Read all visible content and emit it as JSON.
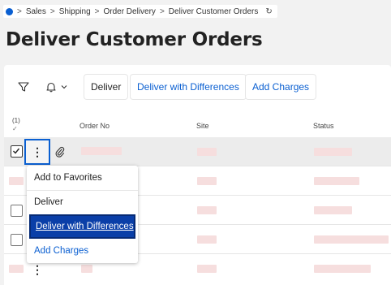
{
  "breadcrumb": {
    "items": [
      "Sales",
      "Shipping",
      "Order Delivery",
      "Deliver Customer Orders"
    ],
    "separator": ">"
  },
  "page_title": "Deliver Customer Orders",
  "toolbar": {
    "deliver_label": "Deliver",
    "deliver_with_differences_label": "Deliver with Differences",
    "add_charges_label": "Add Charges"
  },
  "table": {
    "selected_count": "(1)",
    "columns": [
      "Order No",
      "Site",
      "Status"
    ],
    "row_count": 5
  },
  "context_menu": {
    "items": [
      "Add to Favorites",
      "Deliver",
      "Deliver with Differences",
      "Add Charges"
    ],
    "highlighted": "Deliver with Differences"
  },
  "colors": {
    "accent": "#0a5fd1",
    "menu_highlight": "#0a3fa8",
    "placeholder": "#f6dede"
  }
}
